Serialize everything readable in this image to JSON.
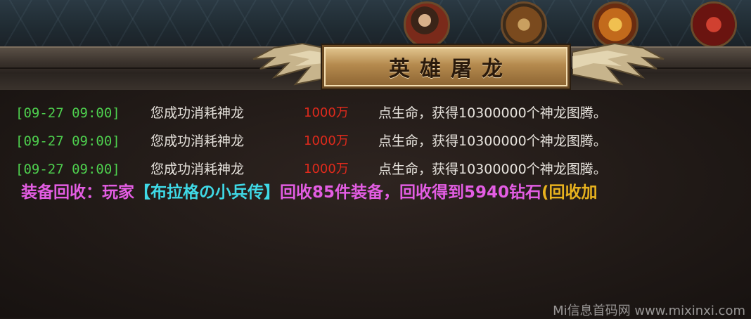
{
  "title": "英雄屠龙",
  "skill_icons": [
    "heroine-portrait-icon",
    "scroll-icon",
    "golden-wheel-icon",
    "red-beast-icon"
  ],
  "log": [
    {
      "timestamp": "[09-27 09:00]",
      "message_a": "您成功消耗神龙",
      "amount": "1000万",
      "message_b": "点生命，获得10300000个神龙图腾。"
    },
    {
      "timestamp": "[09-27 09:00]",
      "message_a": "您成功消耗神龙",
      "amount": "1000万",
      "message_b": "点生命，获得10300000个神龙图腾。"
    },
    {
      "timestamp": "[09-27 09:00]",
      "message_a": "您成功消耗神龙",
      "amount": "1000万",
      "message_b": "点生命，获得10300000个神龙图腾。"
    }
  ],
  "broadcast": {
    "prefix": "装备回收：",
    "player_label": "玩家",
    "player_name": "【布拉格の小兵传】",
    "middle": "回收85件装备，回收得到5940钻石",
    "suffix": "(回收加"
  },
  "watermark": "Mi信息首码网 www.mixinxi.com",
  "colors": {
    "timestamp": "#4ed04e",
    "amount": "#e02a1c",
    "broadcast": "#e35de3",
    "player_name": "#3fd9e6",
    "suffix": "#e8b21e"
  }
}
